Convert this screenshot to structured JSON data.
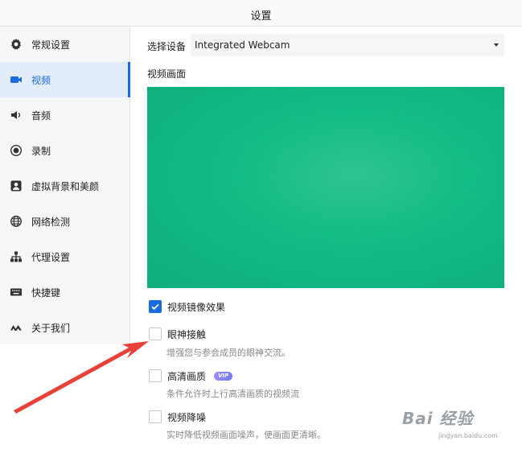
{
  "window": {
    "title": "设置"
  },
  "sidebar": {
    "items": [
      {
        "label": "常规设置",
        "icon": "gear-icon"
      },
      {
        "label": "视频",
        "icon": "video-camera-icon",
        "active": true
      },
      {
        "label": "音频",
        "icon": "speaker-icon"
      },
      {
        "label": "录制",
        "icon": "record-icon"
      },
      {
        "label": "虚拟背景和美颜",
        "icon": "portrait-icon"
      },
      {
        "label": "网络检测",
        "icon": "globe-icon"
      },
      {
        "label": "代理设置",
        "icon": "network-tree-icon"
      },
      {
        "label": "快捷键",
        "icon": "keyboard-icon"
      },
      {
        "label": "关于我们",
        "icon": "tencent-meeting-logo-icon"
      }
    ]
  },
  "video": {
    "device_label": "选择设备",
    "device_value": "Integrated Webcam",
    "preview_label": "视频画面",
    "options": [
      {
        "label": "视频镜像效果",
        "checked": true,
        "desc": ""
      },
      {
        "label": "眼神接触",
        "checked": false,
        "desc": "增强您与参会成员的眼神交流。"
      },
      {
        "label": "高清画质",
        "checked": false,
        "desc": "条件允许时上行高清画质的视频流",
        "badge": "VIP"
      },
      {
        "label": "视频降噪",
        "checked": false,
        "desc": "实时降低视频画面噪声，使画面更清晰。"
      }
    ]
  },
  "colors": {
    "accent": "#1b6be0",
    "preview_green": "#14bc86",
    "annotation_arrow": "#e8413a"
  },
  "watermark": {
    "text": "Bai 经验",
    "sub": "jingyan.baidu.com"
  }
}
